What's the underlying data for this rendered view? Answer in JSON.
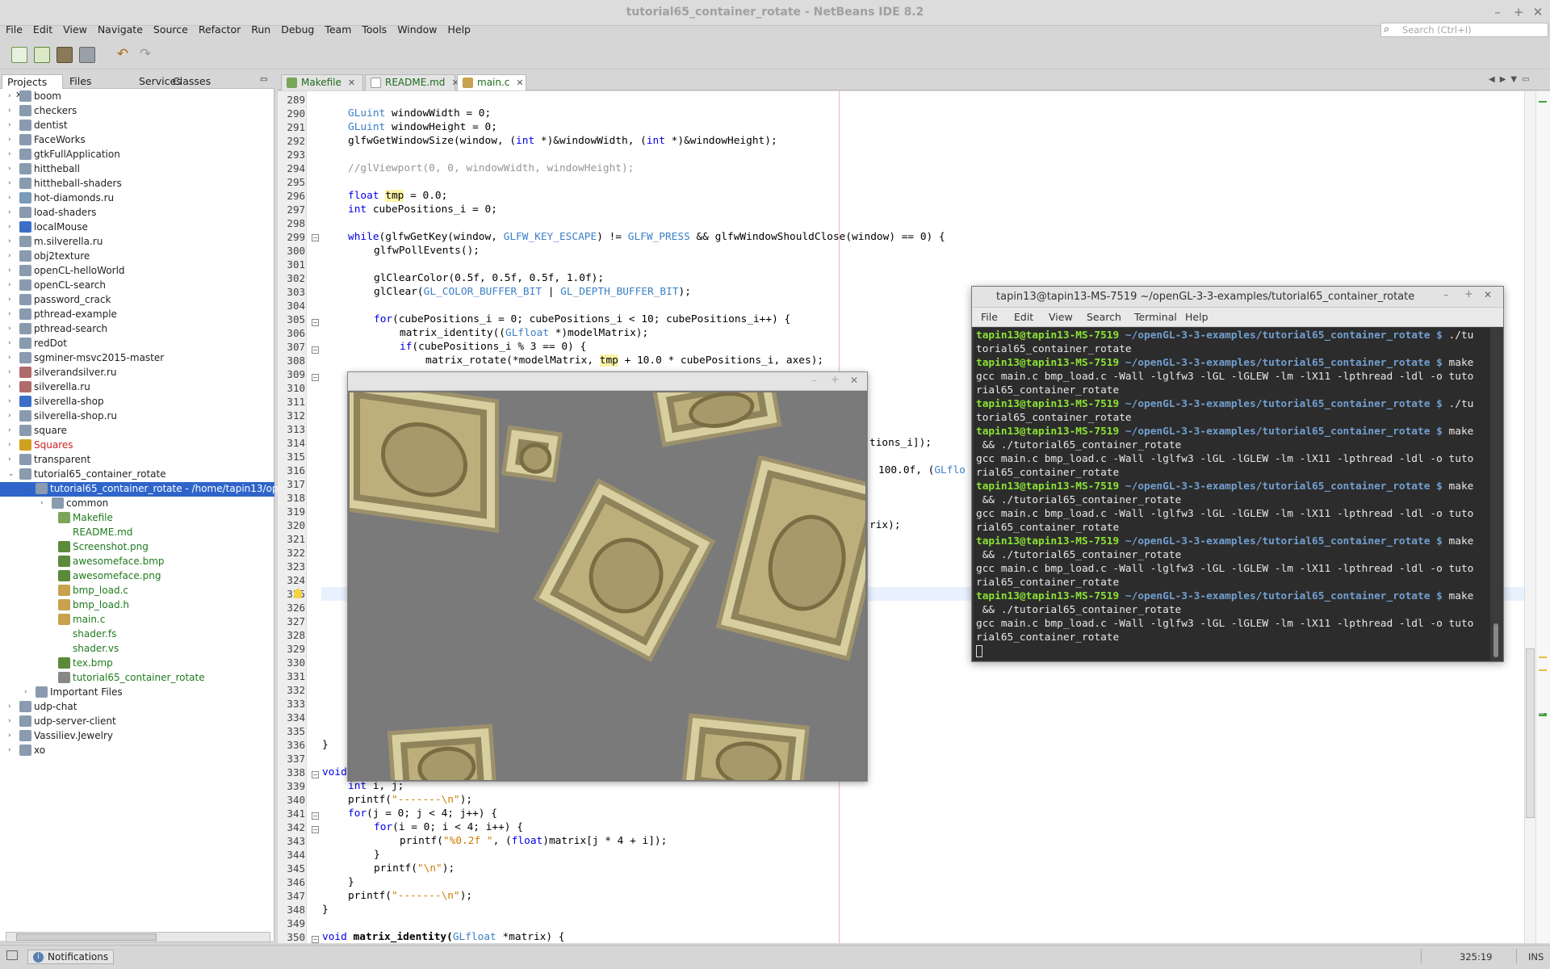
{
  "window": {
    "title": "tutorial65_container_rotate - NetBeans IDE 8.2"
  },
  "menu": [
    "File",
    "Edit",
    "View",
    "Navigate",
    "Source",
    "Refactor",
    "Run",
    "Debug",
    "Team",
    "Tools",
    "Window",
    "Help"
  ],
  "search": {
    "placeholder": "Search (Ctrl+I)"
  },
  "panel_tabs": [
    "Projects",
    "Files",
    "Services",
    "Classes"
  ],
  "projects": [
    "boom",
    "checkers",
    "dentist",
    "FaceWorks",
    "gtkFullApplication",
    "hittheball",
    "hittheball-shaders",
    "hot-diamonds.ru",
    "load-shaders",
    "localMouse",
    "m.silverella.ru",
    "obj2texture",
    "openCL-helloWorld",
    "openCL-search",
    "password_crack",
    "pthread-example",
    "pthread-search",
    "redDot",
    "sgminer-msvc2015-master",
    "silverandsilver.ru",
    "silverella.ru",
    "silverella-shop",
    "silverella-shop.ru",
    "square",
    "Squares",
    "transparent",
    "tutorial65_container_rotate"
  ],
  "project_root": "tutorial65_container_rotate - /home/tapin13/ope",
  "project_files": [
    "common",
    "Makefile",
    "README.md",
    "Screenshot.png",
    "awesomeface.bmp",
    "awesomeface.png",
    "bmp_load.c",
    "bmp_load.h",
    "main.c",
    "shader.fs",
    "shader.vs",
    "tex.bmp",
    "tutorial65_container_rotate"
  ],
  "important_files": "Important Files",
  "projects_after": [
    "udp-chat",
    "udp-server-client",
    "Vassiliev.Jewelry",
    "xo"
  ],
  "editor_tabs": [
    "Makefile",
    "README.md",
    "main.c"
  ],
  "line_numbers": [
    "289",
    "290",
    "291",
    "292",
    "293",
    "294",
    "295",
    "296",
    "297",
    "298",
    "299",
    "300",
    "301",
    "302",
    "303",
    "304",
    "305",
    "306",
    "307",
    "308",
    "309",
    "310",
    "311",
    "312",
    "313",
    "314",
    "315",
    "316",
    "317",
    "318",
    "319",
    "320",
    "321",
    "322",
    "323",
    "324",
    "325",
    "326",
    "327",
    "328",
    "329",
    "330",
    "331",
    "332",
    "333",
    "334",
    "335",
    "336",
    "337",
    "338",
    "339",
    "340",
    "341",
    "342",
    "343",
    "344",
    "345",
    "346",
    "347",
    "348",
    "349",
    "350"
  ],
  "code": {
    "l290a": "GLuint",
    "l290b": " windowWidth = 0;",
    "l291a": "GLuint",
    "l291b": " windowHeight = 0;",
    "l292a": "glfwGetWindowSize(window, (",
    "l292b": "int",
    "l292c": " *)&windowWidth, (",
    "l292d": "int",
    "l292e": " *)&windowHeight);",
    "l294": "//glViewport(0, 0, windowWidth, windowHeight);",
    "l296a": "float",
    "l296b": "tmp",
    "l296c": " = 0.0;",
    "l297a": "int",
    "l297b": " cubePositions_i = 0;",
    "l299a": "while",
    "l299b": "(glfwGetKey(window, ",
    "l299c": "GLFW_KEY_ESCAPE",
    "l299d": ") != ",
    "l299e": "GLFW_PRESS",
    "l299f": " && glfwWindowShouldClose(window) == 0) {",
    "l300": "glfwPollEvents();",
    "l302": "glClearColor(0.5f, 0.5f, 0.5f, 1.0f);",
    "l303a": "glClear(",
    "l303b": "GL_COLOR_BUFFER_BIT",
    "l303c": " | ",
    "l303d": "GL_DEPTH_BUFFER_BIT",
    "l303e": ");",
    "l305a": "for",
    "l305b": "(cubePositions_i = 0; cubePositions_i < 10; cubePositions_i++) {",
    "l306a": "matrix_identity((",
    "l306b": "GLfloat",
    "l306c": " *)modelMatrix);",
    "l307a": "if",
    "l307b": "(cubePositions_i % 3 == 0) {",
    "l308a": "matrix_rotate(*modelMatrix, ",
    "l308b": "tmp",
    "l308c": " + 10.0 * cubePositions_i, axes);",
    "l314": "tions_i]);",
    "l316a": "100.0f, (",
    "l316b": "GLflo",
    "l320": "rix);",
    "l336": "}",
    "l338a": "void",
    "l339a": "int",
    "l339b": " i, j;",
    "l340a": "printf(",
    "l340b": "\"-------\\n\"",
    "l340c": ");",
    "l341a": "for",
    "l341b": "(j = 0; j < 4; j++) {",
    "l342a": "for",
    "l342b": "(i = 0; i < 4; i++) {",
    "l343a": "printf(",
    "l343b": "\"%0.2f \"",
    "l343c": ", (",
    "l343d": "float",
    "l343e": ")matrix[j * 4 + i]);",
    "l344": "}",
    "l345a": "printf(",
    "l345b": "\"\\n\"",
    "l345c": ");",
    "l346": "}",
    "l347a": "printf(",
    "l347b": "\"-------\\n\"",
    "l347c": ");",
    "l348": "}",
    "l350a": "void",
    "l350b": " matrix_identity(",
    "l350c": "GLfloat",
    "l350d": " *matrix) {"
  },
  "terminal": {
    "title": "tapin13@tapin13-MS-7519 ~/openGL-3-3-examples/tutorial65_container_rotate",
    "menu": [
      "File",
      "Edit",
      "View",
      "Search",
      "Terminal",
      "Help"
    ],
    "user": "tapin13@tapin13-MS-7519",
    "path": " ~/openGL-3-3-examples/tutorial65_container_rotate $",
    "lines": [
      {
        "type": "prompt",
        "cmd": " ./tu"
      },
      {
        "type": "out",
        "text": "torial65_container_rotate"
      },
      {
        "type": "prompt",
        "cmd": " make"
      },
      {
        "type": "out",
        "text": "gcc main.c bmp_load.c -Wall -lglfw3 -lGL -lGLEW -lm -lX11 -lpthread -ldl -o tuto"
      },
      {
        "type": "out",
        "text": "rial65_container_rotate"
      },
      {
        "type": "prompt",
        "cmd": " ./tu"
      },
      {
        "type": "out",
        "text": "torial65_container_rotate"
      },
      {
        "type": "prompt",
        "cmd": " make"
      },
      {
        "type": "out",
        "text": " && ./tutorial65_container_rotate"
      },
      {
        "type": "out",
        "text": "gcc main.c bmp_load.c -Wall -lglfw3 -lGL -lGLEW -lm -lX11 -lpthread -ldl -o tuto"
      },
      {
        "type": "out",
        "text": "rial65_container_rotate"
      },
      {
        "type": "prompt",
        "cmd": " make"
      },
      {
        "type": "out",
        "text": " && ./tutorial65_container_rotate"
      },
      {
        "type": "out",
        "text": "gcc main.c bmp_load.c -Wall -lglfw3 -lGL -lGLEW -lm -lX11 -lpthread -ldl -o tuto"
      },
      {
        "type": "out",
        "text": "rial65_container_rotate"
      },
      {
        "type": "prompt",
        "cmd": " make"
      },
      {
        "type": "out",
        "text": " && ./tutorial65_container_rotate"
      },
      {
        "type": "out",
        "text": "gcc main.c bmp_load.c -Wall -lglfw3 -lGL -lGLEW -lm -lX11 -lpthread -ldl -o tuto"
      },
      {
        "type": "out",
        "text": "rial65_container_rotate"
      },
      {
        "type": "prompt",
        "cmd": " make"
      },
      {
        "type": "out",
        "text": " && ./tutorial65_container_rotate"
      },
      {
        "type": "out",
        "text": "gcc main.c bmp_load.c -Wall -lglfw3 -lGL -lGLEW -lm -lX11 -lpthread -ldl -o tuto"
      },
      {
        "type": "out",
        "text": "rial65_container_rotate"
      }
    ]
  },
  "status": {
    "notifications": "Notifications",
    "position": "325:19",
    "mode": "INS"
  },
  "colors": {
    "prompt_user": "#8ae234",
    "prompt_path": "#729fcf",
    "keyword": "#0000e6",
    "type": "#3b80c7",
    "string": "#ce7b00"
  }
}
